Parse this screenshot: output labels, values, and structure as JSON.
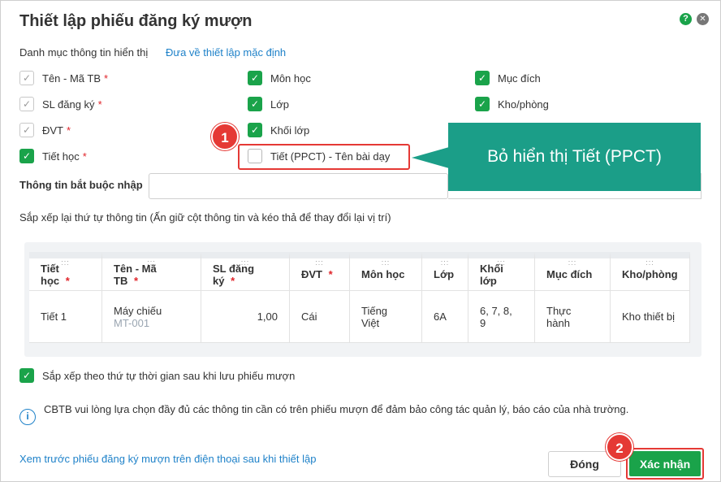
{
  "dialog": {
    "title": "Thiết lập phiếu đăng ký mượn",
    "help_glyph": "?",
    "close_glyph": "✕"
  },
  "display_info": {
    "heading": "Danh mục thông tin hiển thị",
    "reset_link": "Đưa về thiết lập mặc định"
  },
  "fields": {
    "col1": [
      {
        "label": "Tên - Mã TB",
        "required": "*",
        "state": "disabled"
      },
      {
        "label": "SL đăng ký",
        "required": "*",
        "state": "disabled"
      },
      {
        "label": "ĐVT",
        "required": "*",
        "state": "disabled"
      },
      {
        "label": "Tiết học",
        "required": "*",
        "state": "checked"
      }
    ],
    "col2": [
      {
        "label": "Môn học",
        "state": "checked"
      },
      {
        "label": "Lớp",
        "state": "checked"
      },
      {
        "label": "Khối lớp",
        "state": "checked"
      },
      {
        "label": "Tiết (PPCT) - Tên bài dạy",
        "state": "unchecked"
      }
    ],
    "col3": [
      {
        "label": "Mục đích",
        "state": "checked"
      },
      {
        "label": "Kho/phòng",
        "state": "checked"
      }
    ]
  },
  "annotations": {
    "badge1": "1",
    "badge2": "2",
    "callout": "Bỏ hiển thị Tiết (PPCT)"
  },
  "required_info": {
    "label": "Thông tin bắt buộc nhập",
    "value": ""
  },
  "sort_hint": "Sắp xếp lại thứ tự thông tin (Ấn giữ cột thông tin và kéo thả để thay đổi lại vị trí)",
  "table": {
    "grip": ":::",
    "headers": [
      {
        "line1": "Tiết",
        "line2": "học",
        "required": "*"
      },
      {
        "line1": "Tên - Mã",
        "line2": "TB",
        "required": "*"
      },
      {
        "line1": "SL đăng",
        "line2": "ký",
        "required": "*"
      },
      {
        "line1": "ĐVT",
        "line2": "",
        "required": "*"
      },
      {
        "line1": "Môn học",
        "line2": "",
        "required": ""
      },
      {
        "line1": "Lớp",
        "line2": "",
        "required": ""
      },
      {
        "line1": "Khối",
        "line2": "lớp",
        "required": ""
      },
      {
        "line1": "Mục đích",
        "line2": "",
        "required": ""
      },
      {
        "line1": "Kho/phòng",
        "line2": "",
        "required": ""
      }
    ],
    "row": {
      "tiet_hoc": "Tiết 1",
      "device_name": "Máy chiếu",
      "device_code": "MT-001",
      "quantity": "1,00",
      "unit": "Cái",
      "subject_line1": "Tiếng",
      "subject_line2": "Việt",
      "class": "6A",
      "grade_line1": "6, 7, 8,",
      "grade_line2": "9",
      "purpose_line1": "Thực",
      "purpose_line2": "hành",
      "room": "Kho thiết bị"
    }
  },
  "sort_option": {
    "label": "Sắp xếp theo thứ tự thời gian sau khi lưu phiếu mượn",
    "state": "checked"
  },
  "info": {
    "icon_glyph": "i",
    "text": "CBTB vui lòng lựa chọn đầy đủ các thông tin cần có trên phiếu mượn để đảm bảo công tác quản lý, báo cáo của nhà trường."
  },
  "footer": {
    "preview_link": "Xem trước phiếu đăng ký mượn trên điện thoại sau khi thiết lập",
    "close_button": "Đóng",
    "confirm_button": "Xác nhận"
  },
  "colors": {
    "accent_green": "#1aa34a",
    "link_blue": "#1f82c9",
    "annotation_red": "#e53935",
    "callout_teal": "#1b9e88"
  }
}
